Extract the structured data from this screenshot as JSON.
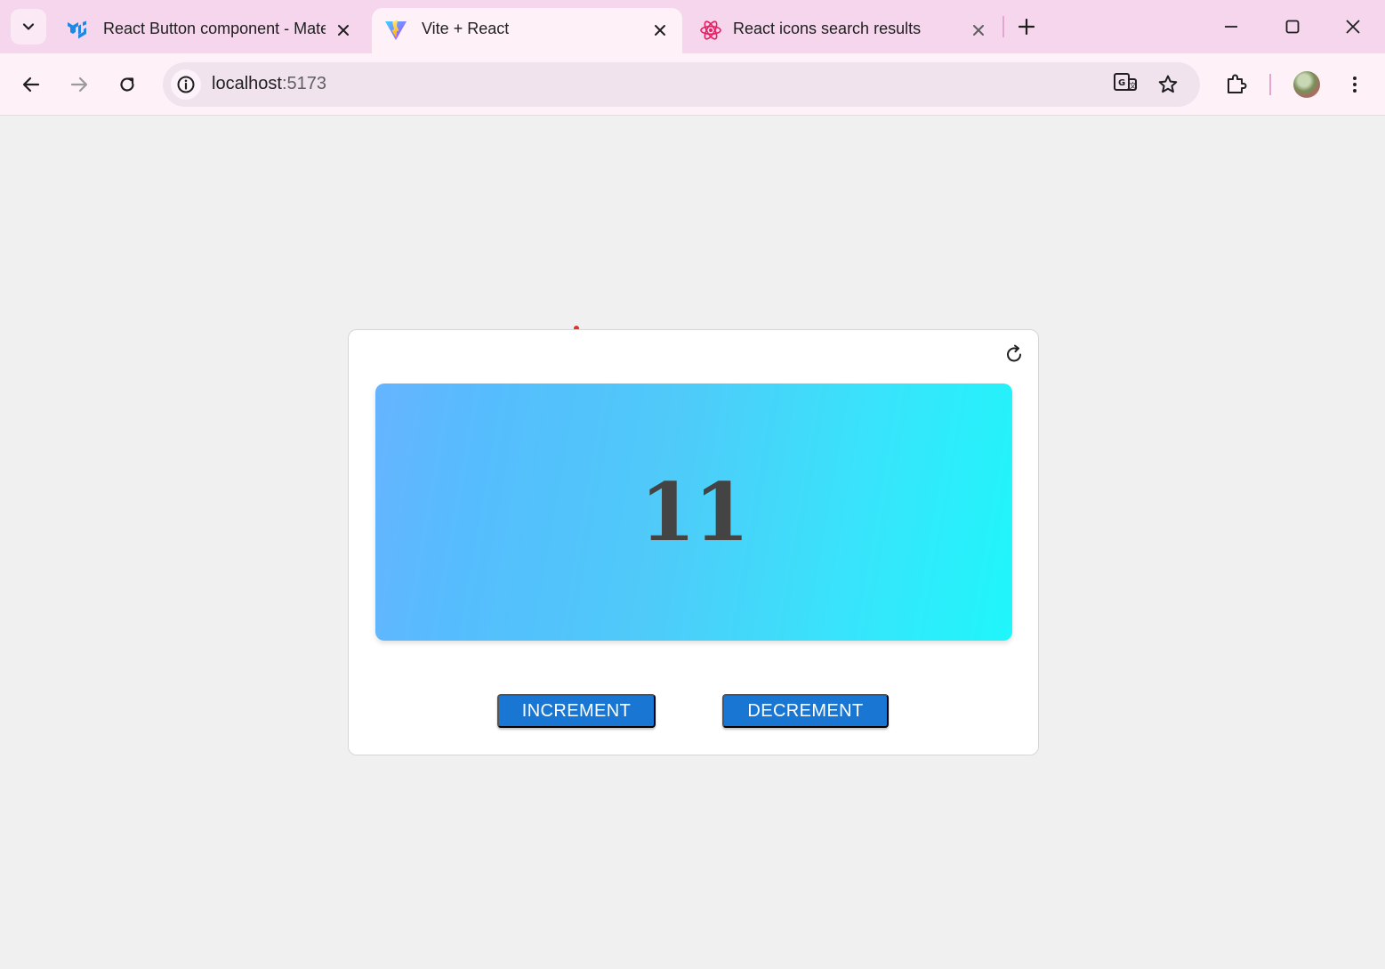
{
  "browser": {
    "tabs": [
      {
        "title": "React Button component - Material UI",
        "icon": "mui-logo-icon",
        "active": false
      },
      {
        "title": "Vite + React",
        "icon": "vite-logo-icon",
        "active": true
      },
      {
        "title": "React icons search results",
        "icon": "react-logo-icon",
        "active": false
      }
    ],
    "address": {
      "host": "localhost",
      "port": ":5173"
    }
  },
  "colors": {
    "tabstrip": "#f5d6ec",
    "toolbar": "#fff1f8",
    "page_bg": "#f0f0f0",
    "button_primary": "#1976d2",
    "gradient_start": "#66b4ff",
    "gradient_end": "#1ff6fb",
    "count_text": "#444444"
  },
  "app": {
    "count": "11",
    "increment_label": "INCREMENT",
    "decrement_label": "DECREMENT"
  }
}
